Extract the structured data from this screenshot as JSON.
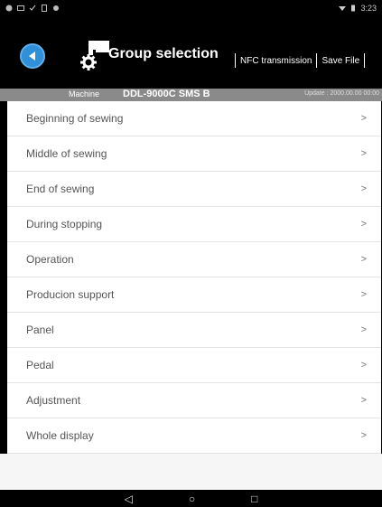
{
  "status_bar": {
    "time": "3:23",
    "left_icons": [
      "vpn-icon",
      "message-icon",
      "check-icon",
      "clipboard-icon",
      "sync-icon"
    ],
    "right_icons": [
      "wifi-icon",
      "battery-icon"
    ]
  },
  "header": {
    "title": "Group selection",
    "nfc_label": "NFC transmission",
    "save_label": "Save File"
  },
  "machine_bar": {
    "label": "Machine",
    "value": "DDL-9000C SMS B",
    "update": "Update : 2000.00.00 00:00"
  },
  "menu": {
    "items": [
      {
        "label": "Beginning of sewing",
        "chevron": ">"
      },
      {
        "label": "Middle of sewing",
        "chevron": ">"
      },
      {
        "label": "End of sewing",
        "chevron": ">"
      },
      {
        "label": "During stopping",
        "chevron": ">"
      },
      {
        "label": "Operation",
        "chevron": ">"
      },
      {
        "label": "Producion support",
        "chevron": ">"
      },
      {
        "label": "Panel",
        "chevron": ">"
      },
      {
        "label": "Pedal",
        "chevron": ">"
      },
      {
        "label": "Adjustment",
        "chevron": ">"
      },
      {
        "label": "Whole display",
        "chevron": ">"
      }
    ]
  },
  "nav": {
    "back": "◁",
    "home": "○",
    "recents": "□"
  },
  "colors": {
    "accent": "#2f8fd8",
    "header_bg": "#000000",
    "info_bar_bg": "#8a8a8a",
    "list_bg": "#ffffff"
  }
}
